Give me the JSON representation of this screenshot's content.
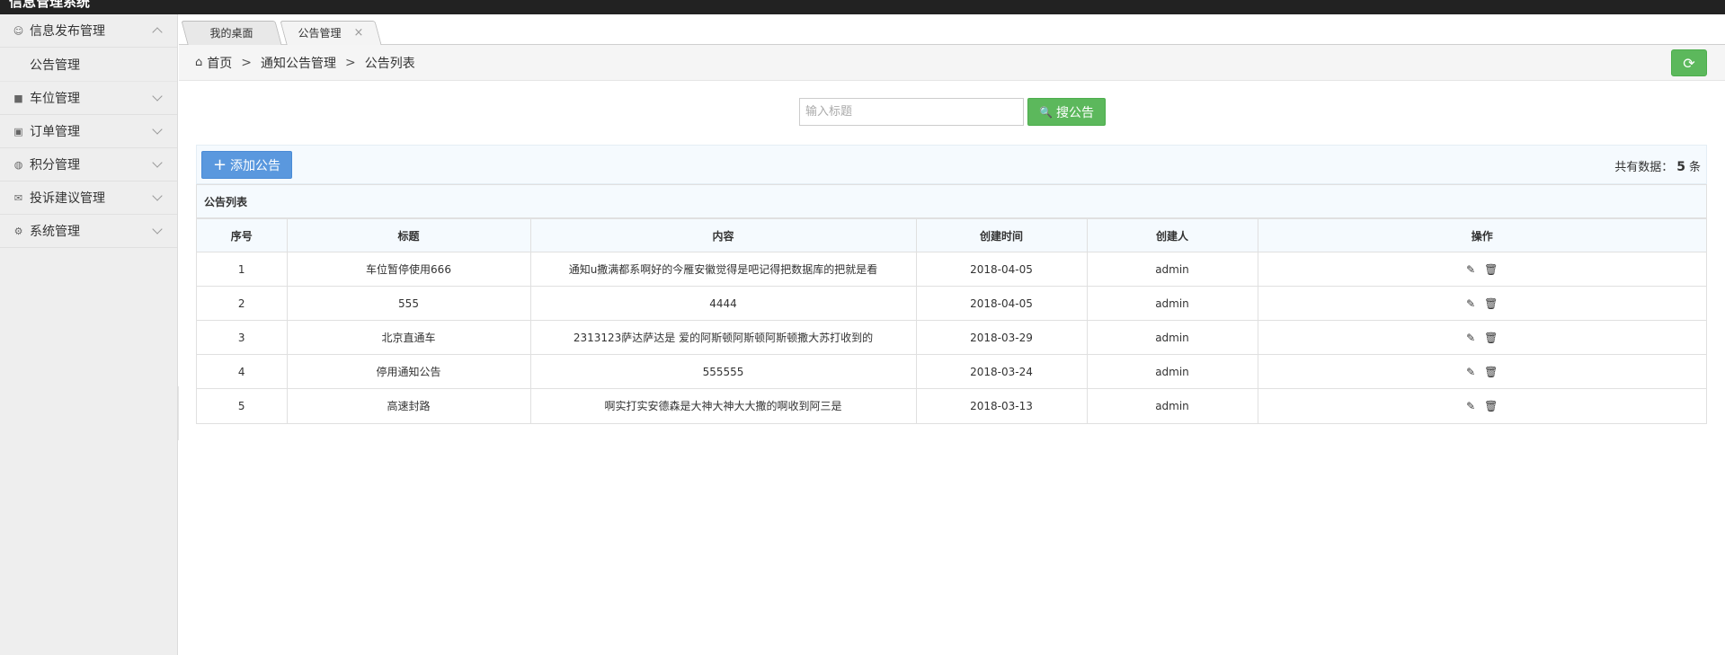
{
  "app": {
    "brand": "信息管理系统"
  },
  "sidebar": {
    "items": [
      {
        "label": "信息发布管理",
        "icon": "message-icon",
        "glyph": "☺",
        "expanded": true,
        "children": [
          {
            "label": "公告管理"
          }
        ]
      },
      {
        "label": "车位管理",
        "icon": "truck-icon",
        "glyph": "■",
        "expanded": false
      },
      {
        "label": "订单管理",
        "icon": "order-icon",
        "glyph": "▣",
        "expanded": false
      },
      {
        "label": "积分管理",
        "icon": "database-icon",
        "glyph": "◍",
        "expanded": false
      },
      {
        "label": "投诉建议管理",
        "icon": "mail-icon",
        "glyph": "✉",
        "expanded": false
      },
      {
        "label": "系统管理",
        "icon": "gear-icon",
        "glyph": "⚙",
        "expanded": false
      }
    ]
  },
  "tabs": [
    {
      "label": "我的桌面"
    },
    {
      "label": "公告管理",
      "close": "×"
    }
  ],
  "breadcrumb": {
    "home": "首页",
    "level1": "通知公告管理",
    "level2": "公告列表",
    "separator": ">"
  },
  "search": {
    "placeholder": "输入标题",
    "button": "搜公告"
  },
  "toolbar": {
    "add_label": "添加公告",
    "total_prefix": "共有数据：",
    "total_count": "5",
    "total_suffix": "条"
  },
  "table": {
    "caption": "公告列表",
    "headers": [
      "序号",
      "标题",
      "内容",
      "创建时间",
      "创建人",
      "操作"
    ],
    "rows": [
      {
        "id": "1",
        "title": "车位暂停使用666",
        "content": "通知u撒满都系啊好的今雁安徽觉得是吧记得把数据库的把就是看",
        "created": "2018-04-05",
        "creator": "admin"
      },
      {
        "id": "2",
        "title": "555",
        "content": "4444",
        "created": "2018-04-05",
        "creator": "admin"
      },
      {
        "id": "3",
        "title": "北京直通车",
        "content": "2313123萨达萨达是 爱的阿斯顿阿斯顿阿斯顿撒大苏打收到的",
        "created": "2018-03-29",
        "creator": "admin"
      },
      {
        "id": "4",
        "title": "停用通知公告",
        "content": "555555",
        "created": "2018-03-24",
        "creator": "admin"
      },
      {
        "id": "5",
        "title": "高速封路",
        "content": "啊实打实安德森是大神大神大大撒的啊收到阿三是",
        "created": "2018-03-13",
        "creator": "admin"
      }
    ]
  },
  "colors": {
    "green": "#5cb85c",
    "blue": "#5a98de",
    "topbar": "#222222"
  }
}
